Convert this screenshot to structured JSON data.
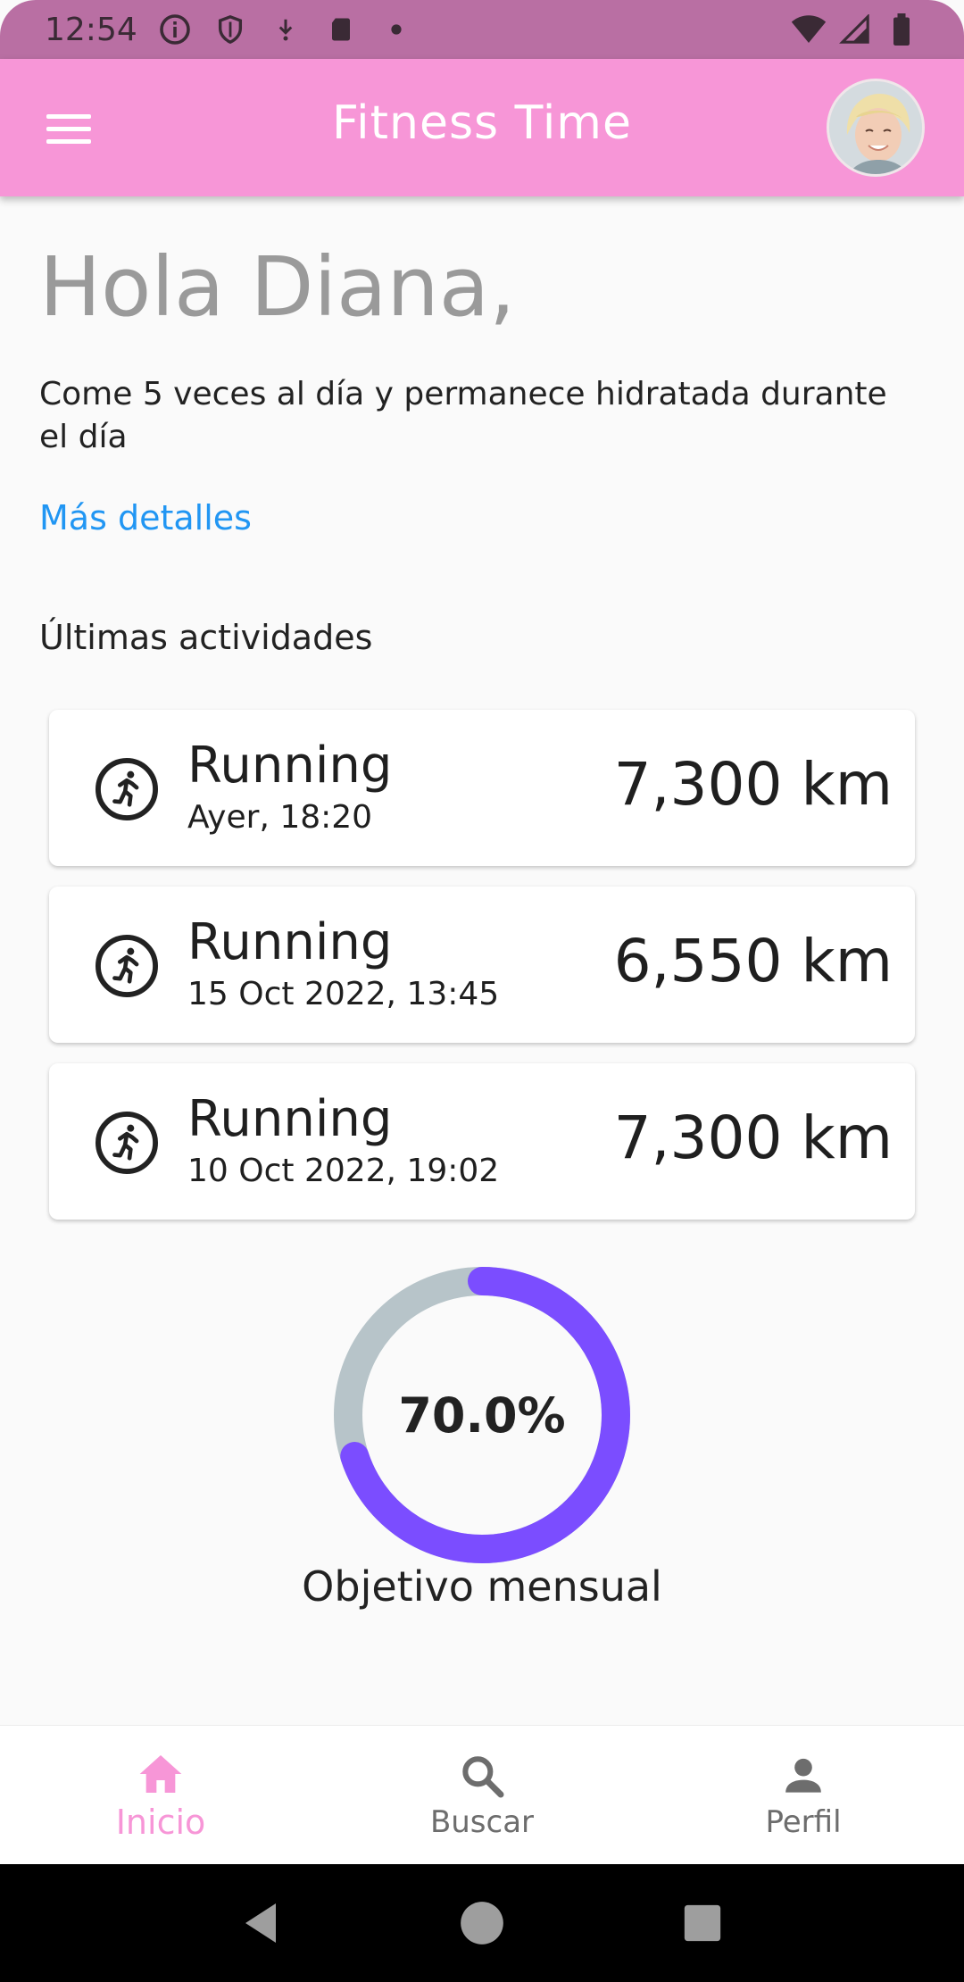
{
  "status_bar": {
    "time": "12:54",
    "icons_left": [
      "info-icon",
      "shield-icon",
      "download-icon",
      "sd-card-icon",
      "dot-icon"
    ],
    "icons_right": [
      "wifi-icon",
      "signal-icon",
      "battery-icon"
    ]
  },
  "app_bar": {
    "title": "Fitness Time",
    "menu_icon": "menu-icon",
    "avatar": "user-avatar"
  },
  "greeting": "Hola Diana,",
  "tip": "Come 5 veces al día y permanece hidratada durante el día",
  "more_link": "Más detalles",
  "section_title": "Últimas actividades",
  "activities": [
    {
      "icon": "running-icon",
      "name": "Running",
      "date": "Ayer, 18:20",
      "distance": "7,300 km"
    },
    {
      "icon": "running-icon",
      "name": "Running",
      "date": "15 Oct 2022, 13:45",
      "distance": "6,550 km"
    },
    {
      "icon": "running-icon",
      "name": "Running",
      "date": "10 Oct 2022, 19:02",
      "distance": "7,300 km"
    }
  ],
  "monthly_goal": {
    "value_text": "70.0%",
    "progress": 0.7,
    "label": "Objetivo mensual",
    "progress_color": "#7b4dff",
    "track_color": "#b7c4c9"
  },
  "bottom_nav": [
    {
      "icon": "home-icon",
      "label": "Inicio",
      "active": true
    },
    {
      "icon": "search-icon",
      "label": "Buscar",
      "active": false
    },
    {
      "icon": "person-icon",
      "label": "Perfil",
      "active": false
    }
  ],
  "system_nav": [
    "back-icon",
    "home-circle-icon",
    "recents-icon"
  ],
  "colors": {
    "app_bar": "#f796d7",
    "status_bar": "#b96fa3",
    "link": "#2196f3",
    "accent_active": "#f796d7"
  }
}
